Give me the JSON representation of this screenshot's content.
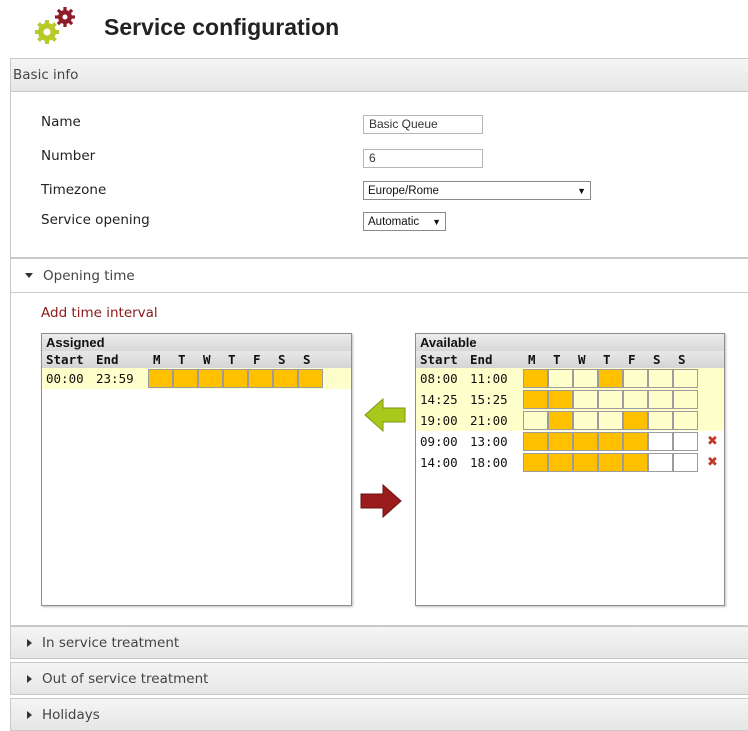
{
  "page": {
    "title": "Service configuration"
  },
  "basic_info": {
    "header": "Basic info",
    "fields": {
      "name_label": "Name",
      "name_value": "Basic Queue",
      "number_label": "Number",
      "number_value": "6",
      "timezone_label": "Timezone",
      "timezone_value": "Europe/Rome",
      "opening_label": "Service opening",
      "opening_value": "Automatic"
    }
  },
  "opening_time": {
    "header": "Opening time",
    "add_link": "Add time interval",
    "assigned": {
      "title": "Assigned",
      "columns": {
        "start": "Start",
        "end": "End",
        "days": [
          "M",
          "T",
          "W",
          "T",
          "F",
          "S",
          "S"
        ]
      },
      "rows": [
        {
          "start": "00:00",
          "end": "23:59",
          "days": [
            1,
            1,
            1,
            1,
            1,
            1,
            1
          ],
          "highlight": true
        }
      ]
    },
    "available": {
      "title": "Available",
      "columns": {
        "start": "Start",
        "end": "End",
        "days": [
          "M",
          "T",
          "W",
          "T",
          "F",
          "S",
          "S"
        ]
      },
      "rows": [
        {
          "start": "08:00",
          "end": "11:00",
          "days": [
            1,
            0,
            0,
            1,
            0,
            0,
            0
          ],
          "highlight": true,
          "deletable": false
        },
        {
          "start": "14:25",
          "end": "15:25",
          "days": [
            1,
            1,
            0,
            0,
            0,
            0,
            0
          ],
          "highlight": true,
          "deletable": false
        },
        {
          "start": "19:00",
          "end": "21:00",
          "days": [
            0,
            1,
            0,
            0,
            1,
            0,
            0
          ],
          "highlight": true,
          "deletable": false
        },
        {
          "start": "09:00",
          "end": "13:00",
          "days": [
            1,
            1,
            1,
            1,
            1,
            0,
            0
          ],
          "highlight": false,
          "deletable": true
        },
        {
          "start": "14:00",
          "end": "18:00",
          "days": [
            1,
            1,
            1,
            1,
            1,
            0,
            0
          ],
          "highlight": false,
          "deletable": true
        }
      ]
    },
    "colors": {
      "on": "#ffc000",
      "highlight": "#ffffcc",
      "arrow_left": "#a8c81c",
      "arrow_right": "#9b1c1c"
    }
  },
  "sections": [
    {
      "label": "In service treatment"
    },
    {
      "label": "Out of service treatment"
    },
    {
      "label": "Holidays"
    }
  ]
}
